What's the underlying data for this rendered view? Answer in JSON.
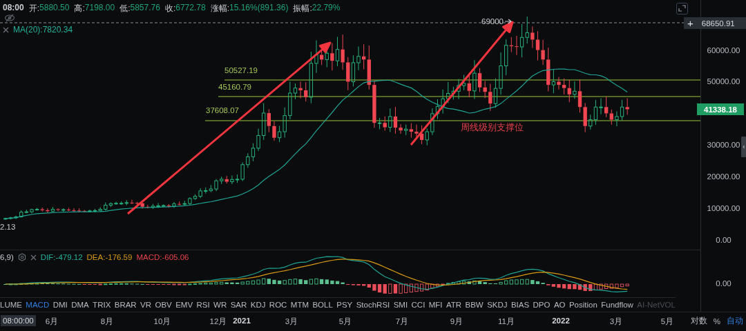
{
  "ohlc_header": {
    "time": "08:00",
    "fields": [
      {
        "label": "开:",
        "value": "5880.50"
      },
      {
        "label": "高:",
        "value": "7198.00"
      },
      {
        "label": "低:",
        "value": "5857.76"
      },
      {
        "label": "收:",
        "value": "6772.78"
      },
      {
        "label": "涨幅:",
        "value": "15.16%(891.36)"
      },
      {
        "label": "振幅:",
        "value": "22.79%"
      }
    ]
  },
  "moving_average": {
    "label": "MA(20):7820.34"
  },
  "price_note": "2.13",
  "high_marker": "69000",
  "crosshair": {
    "button": "+",
    "price": "68650.91"
  },
  "level_lines": [
    {
      "label": "50527.19"
    },
    {
      "label": "45160.79"
    },
    {
      "label": "37608.07"
    }
  ],
  "annotation": "周线级别支撑位",
  "price_axis": {
    "ticks": [
      "60000.00",
      "50000.00",
      "30000.00",
      "20000.00",
      "10000.00",
      "0.00"
    ],
    "current_price": "41338.18"
  },
  "macd": {
    "params": "6,9)",
    "dif": "DIF:-479.12",
    "dea": "DEA:-176.59",
    "value": "MACD:-605.06",
    "axis_tick": "0.00"
  },
  "indicator_tabs": [
    {
      "label": "LUME",
      "selected": false,
      "disabled": false
    },
    {
      "label": "MACD",
      "selected": true,
      "disabled": false
    },
    {
      "label": "DMI",
      "selected": false,
      "disabled": false
    },
    {
      "label": "DMA",
      "selected": false,
      "disabled": false
    },
    {
      "label": "TRIX",
      "selected": false,
      "disabled": false
    },
    {
      "label": "BRAR",
      "selected": false,
      "disabled": false
    },
    {
      "label": "VR",
      "selected": false,
      "disabled": false
    },
    {
      "label": "OBV",
      "selected": false,
      "disabled": false
    },
    {
      "label": "EMV",
      "selected": false,
      "disabled": false
    },
    {
      "label": "RSI",
      "selected": false,
      "disabled": false
    },
    {
      "label": "WR",
      "selected": false,
      "disabled": false
    },
    {
      "label": "SAR",
      "selected": false,
      "disabled": false
    },
    {
      "label": "KDJ",
      "selected": false,
      "disabled": false
    },
    {
      "label": "ROC",
      "selected": false,
      "disabled": false
    },
    {
      "label": "MTM",
      "selected": false,
      "disabled": false
    },
    {
      "label": "BOLL",
      "selected": false,
      "disabled": false
    },
    {
      "label": "PSY",
      "selected": false,
      "disabled": false
    },
    {
      "label": "StochRSI",
      "selected": false,
      "disabled": false
    },
    {
      "label": "SMI",
      "selected": false,
      "disabled": false
    },
    {
      "label": "CCI",
      "selected": false,
      "disabled": false
    },
    {
      "label": "MFI",
      "selected": false,
      "disabled": false
    },
    {
      "label": "ATR",
      "selected": false,
      "disabled": false
    },
    {
      "label": "BBW",
      "selected": false,
      "disabled": false
    },
    {
      "label": "SKDJ",
      "selected": false,
      "disabled": false
    },
    {
      "label": "BIAS",
      "selected": false,
      "disabled": false
    },
    {
      "label": "DPO",
      "selected": false,
      "disabled": false
    },
    {
      "label": "AO",
      "selected": false,
      "disabled": false
    },
    {
      "label": "Position",
      "selected": false,
      "disabled": false
    },
    {
      "label": "Fundflow",
      "selected": false,
      "disabled": false
    },
    {
      "label": "AI-NetVOL",
      "selected": false,
      "disabled": true
    }
  ],
  "time_axis": {
    "cursor_time": "08:00:00",
    "labels": [
      {
        "text": "6月",
        "kind": "month"
      },
      {
        "text": "8月",
        "kind": "month"
      },
      {
        "text": "10月",
        "kind": "month"
      },
      {
        "text": "12月",
        "kind": "month"
      },
      {
        "text": "2021",
        "kind": "year"
      },
      {
        "text": "3月",
        "kind": "month"
      },
      {
        "text": "5月",
        "kind": "month"
      },
      {
        "text": "7月",
        "kind": "month"
      },
      {
        "text": "9月",
        "kind": "month"
      },
      {
        "text": "11月",
        "kind": "month"
      },
      {
        "text": "2022",
        "kind": "year"
      },
      {
        "text": "3月",
        "kind": "month"
      },
      {
        "text": "5月",
        "kind": "month"
      }
    ]
  },
  "scale_options": [
    {
      "label": "对数",
      "selected": false
    },
    {
      "label": "%",
      "selected": false
    },
    {
      "label": "自动",
      "selected": true
    }
  ]
}
